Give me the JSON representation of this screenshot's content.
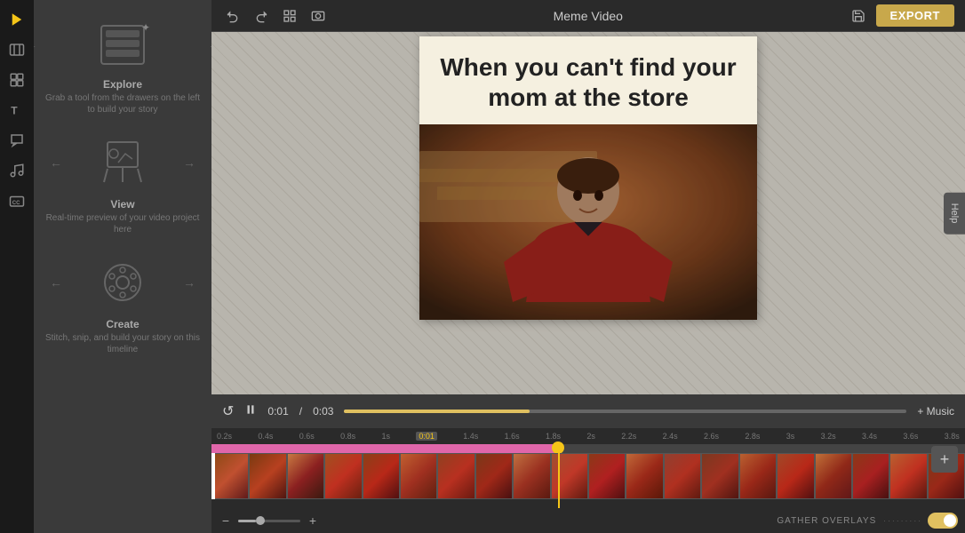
{
  "app": {
    "title": "Meme Video",
    "export_label": "EXPORT",
    "help_label": "Help"
  },
  "header": {
    "undo_label": "↺",
    "redo_label": "↻",
    "screenshot_label": "⊞",
    "camera_label": "⊡"
  },
  "meme": {
    "text_line1": "When you can't find your",
    "text_line2": "mom at the store"
  },
  "controls": {
    "play_label": "▶",
    "pause_label": "⏸",
    "loop_label": "↺",
    "current_time": "0:01",
    "separator": "/",
    "total_time": "0:03",
    "music_label": "+ Music"
  },
  "timeline": {
    "timecodes": [
      "0.2s",
      "0.4s",
      "0.6s",
      "0.8s",
      "1s",
      "0:01",
      "1.4s",
      "1.6s",
      "1.8s",
      "2s",
      "2.2s",
      "2.4s",
      "2.6s",
      "2.8s",
      "3s",
      "3.2s",
      "3.4s",
      "3.6s",
      "3.8s"
    ],
    "current_time_marker": "0:01"
  },
  "sidebar": {
    "items": [
      {
        "name": "logo",
        "icon": "▶"
      },
      {
        "name": "media",
        "icon": "🎬"
      },
      {
        "name": "template",
        "icon": "⊞"
      },
      {
        "name": "text",
        "icon": "T"
      },
      {
        "name": "speech-bubble",
        "icon": "💬"
      },
      {
        "name": "music",
        "icon": "♪"
      },
      {
        "name": "captions",
        "icon": "CC"
      }
    ]
  },
  "tools": {
    "explore": {
      "label": "Explore",
      "desc": "Grab a tool from the drawers on the left to build your story"
    },
    "view": {
      "label": "View",
      "desc": "Real-time preview of your video project here"
    },
    "create": {
      "label": "Create",
      "desc": "Stitch, snip, and build your story on this timeline"
    }
  },
  "bottom": {
    "gather_overlays_label": "GATHER OVERLAYS",
    "zoom_minus": "−",
    "zoom_plus": "+"
  }
}
